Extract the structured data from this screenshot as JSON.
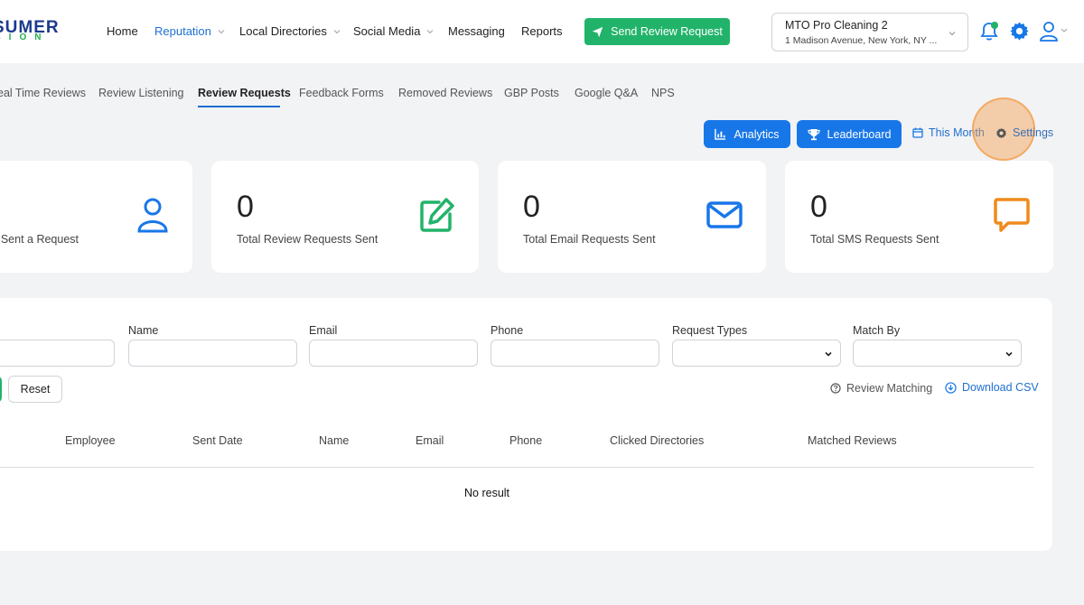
{
  "brand": {
    "logo_top": "SUMER",
    "logo_bottom": "SION",
    "accent": "#1877e8",
    "green": "#22b36a"
  },
  "nav": {
    "items": [
      {
        "label": "Home",
        "active": false
      },
      {
        "label": "Reputation",
        "active": true
      },
      {
        "label": "Local Directories",
        "active": false
      },
      {
        "label": "Social Media",
        "active": false
      },
      {
        "label": "Messaging",
        "active": false
      },
      {
        "label": "Reports",
        "active": false
      }
    ],
    "send_button": "Send Review Request"
  },
  "location": {
    "name": "MTO Pro Cleaning 2",
    "address": "1 Madison Avenue, New York, NY ..."
  },
  "header_icons": [
    "bell-icon",
    "gear-icon",
    "user-icon"
  ],
  "tabs": {
    "items": [
      "eal Time Reviews",
      "Review Listening",
      "Review Requests",
      "Feedback Forms",
      "Removed Reviews",
      "GBP Posts",
      "Google Q&A",
      "NPS"
    ],
    "active_index": 2
  },
  "toolbar": {
    "analytics": "Analytics",
    "leaderboard": "Leaderboard",
    "date_range": "This Month",
    "settings": "Settings"
  },
  "stats": [
    {
      "value": "",
      "label": "ers Sent a Request",
      "icon": "user-icon",
      "color": "#1877e8"
    },
    {
      "value": "0",
      "label": "Total Review Requests Sent",
      "icon": "edit-icon",
      "color": "#22b36a"
    },
    {
      "value": "0",
      "label": "Total Email Requests Sent",
      "icon": "mail-icon",
      "color": "#1877e8"
    },
    {
      "value": "0",
      "label": "Total SMS Requests Sent",
      "icon": "chat-icon",
      "color": "#f08a1c"
    }
  ],
  "filters": {
    "name_label": "Name",
    "email_label": "Email",
    "phone_label": "Phone",
    "request_types_label": "Request Types",
    "match_by_label": "Match By",
    "reset": "Reset",
    "review_matching": "Review Matching",
    "download_csv": "Download CSV"
  },
  "table": {
    "columns": [
      "Employee",
      "Sent Date",
      "Name",
      "Email",
      "Phone",
      "Clicked Directories",
      "Matched Reviews"
    ],
    "empty_text": "No result"
  }
}
